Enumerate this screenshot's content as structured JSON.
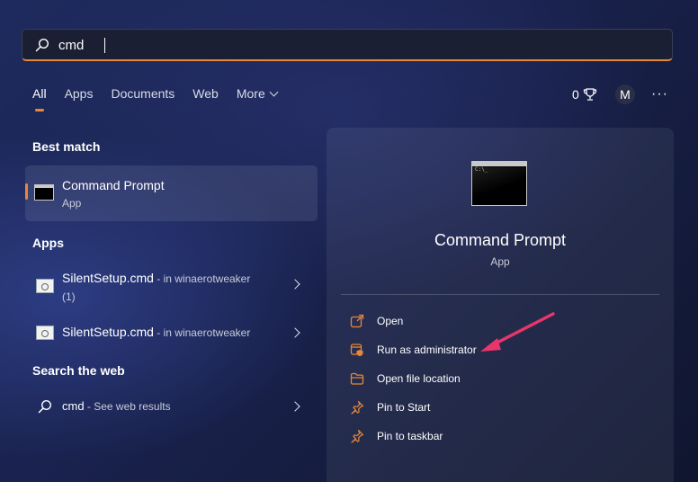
{
  "search": {
    "query": "cmd"
  },
  "tabs": [
    {
      "label": "All"
    },
    {
      "label": "Apps"
    },
    {
      "label": "Documents"
    },
    {
      "label": "Web"
    },
    {
      "label": "More"
    }
  ],
  "rewards": {
    "count": "0"
  },
  "user": {
    "initial": "M"
  },
  "more_menu": {
    "label": "···"
  },
  "sections": {
    "best_match": "Best match",
    "apps": "Apps",
    "search_web": "Search the web"
  },
  "best_match": {
    "name": "Command Prompt",
    "type": "App"
  },
  "apps": [
    {
      "file": "SilentSetup.cmd",
      "location": " - in winaerotweaker",
      "extra": "(1)"
    },
    {
      "file": "SilentSetup.cmd",
      "location": " - in winaerotweaker",
      "extra": ""
    }
  ],
  "web": {
    "query": "cmd",
    "hint": " - See web results"
  },
  "details": {
    "title": "Command Prompt",
    "type": "App",
    "actions": [
      {
        "label": "Open",
        "icon": "open-external-icon"
      },
      {
        "label": "Run as administrator",
        "icon": "shield-admin-icon"
      },
      {
        "label": "Open file location",
        "icon": "folder-icon"
      },
      {
        "label": "Pin to Start",
        "icon": "pin-icon"
      },
      {
        "label": "Pin to taskbar",
        "icon": "pin-icon"
      }
    ]
  },
  "colors": {
    "accent": "#e8873a",
    "annotation_arrow": "#e8356a"
  }
}
